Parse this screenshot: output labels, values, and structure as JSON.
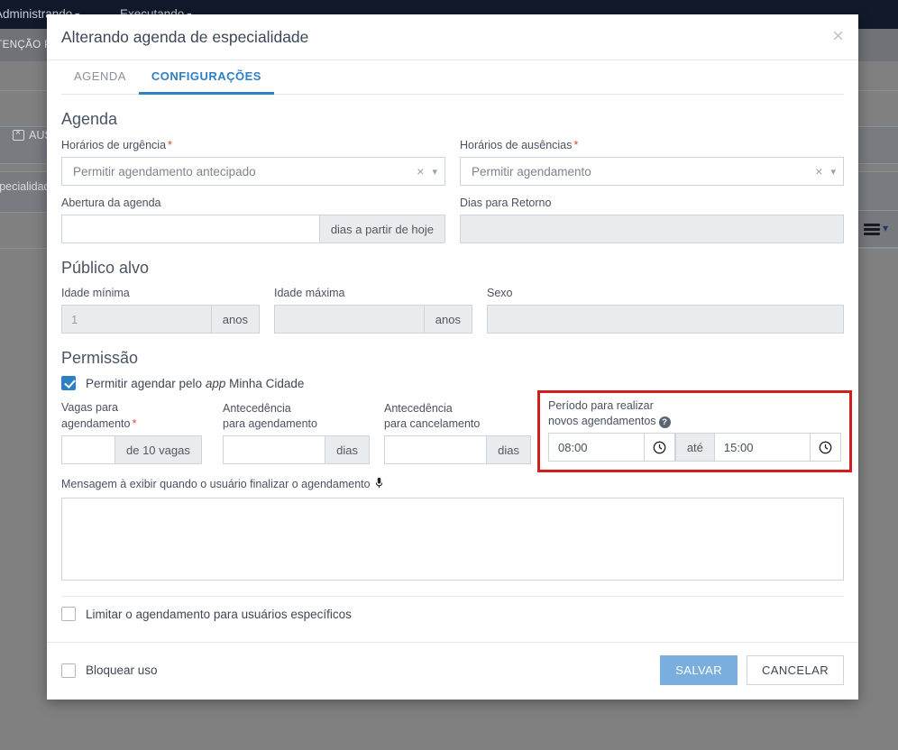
{
  "background": {
    "navbar": {
      "items": [
        {
          "label": "Administrando",
          "caret": "chevron-down"
        },
        {
          "label": "Executando",
          "caret": "chevron-down"
        }
      ]
    },
    "subbar_text": "ATENÇÃO PRI",
    "tag_absence": "AUS",
    "tag_specialty": "especialidade",
    "menu_icon": "hamburger-menu"
  },
  "modal": {
    "title": "Alterando agenda de especialidade",
    "close_icon": "close-icon",
    "tabs": [
      {
        "label": "AGENDA",
        "active": false
      },
      {
        "label": "CONFIGURAÇÕES",
        "active": true
      }
    ],
    "sections": {
      "agenda": {
        "title": "Agenda",
        "urgencia": {
          "label": "Horários de urgência",
          "required": "*",
          "value": "Permitir agendamento antecipado",
          "clear_icon": "clear-icon",
          "caret_icon": "chevron-down-icon"
        },
        "ausencias": {
          "label": "Horários de ausências",
          "required": "*",
          "value": "Permitir agendamento",
          "clear_icon": "clear-icon",
          "caret_icon": "chevron-down-icon"
        },
        "abertura": {
          "label": "Abertura da agenda",
          "value": "",
          "placeholder": "",
          "addon": "dias a partir de hoje"
        },
        "retorno": {
          "label": "Dias para Retorno",
          "value": "",
          "placeholder": "",
          "disabled": true
        }
      },
      "publico": {
        "title": "Público alvo",
        "idade_min": {
          "label": "Idade mínima",
          "value": "",
          "placeholder": "1",
          "addon": "anos",
          "disabled": true
        },
        "idade_max": {
          "label": "Idade máxima",
          "value": "",
          "placeholder": "",
          "addon": "anos",
          "disabled": true
        },
        "sexo": {
          "label": "Sexo",
          "value": "",
          "placeholder": "",
          "disabled": true
        }
      },
      "permissao": {
        "title": "Permissão",
        "permitir_app": {
          "label_part1": "Permitir agendar pelo ",
          "label_italic": "app",
          "label_part2": " Minha Cidade",
          "checked": true
        },
        "vagas": {
          "label_line1": "Vagas para",
          "label_line2": "agendamento",
          "required": "*",
          "value": "",
          "addon": "de 10 vagas"
        },
        "antecedencia_agendamento": {
          "label_line1": "Antecedência",
          "label_line2": "para agendamento",
          "value": "",
          "addon": "dias"
        },
        "antecedencia_cancelamento": {
          "label_line1": "Antecedência",
          "label_line2": "para cancelamento",
          "value": "",
          "addon": "dias"
        },
        "periodo": {
          "label_line1": "Período para realizar",
          "label_line2": "novos agendamentos",
          "help_icon": "help-icon",
          "help_glyph": "?",
          "start_value": "08:00",
          "start_icon": "clock-icon",
          "separator": "até",
          "end_value": "15:00",
          "end_icon": "clock-icon",
          "highlight_color": "#d21d1d"
        },
        "mensagem": {
          "label": "Mensagem à exibir quando o usuário finalizar o agendamento",
          "mic_icon": "microphone-icon",
          "value": "",
          "placeholder": ""
        },
        "limitar": {
          "label": "Limitar o agendamento para usuários específicos",
          "checked": false
        }
      }
    },
    "footer": {
      "bloquear": {
        "label": "Bloquear uso",
        "checked": false
      },
      "save_label": "SALVAR",
      "cancel_label": "CANCELAR"
    }
  },
  "colors": {
    "accent": "#2f7fc4",
    "primary_button": "#7aaedd",
    "highlight": "#d21d1d",
    "required": "#d9453c",
    "navbar": "#111a2b"
  }
}
